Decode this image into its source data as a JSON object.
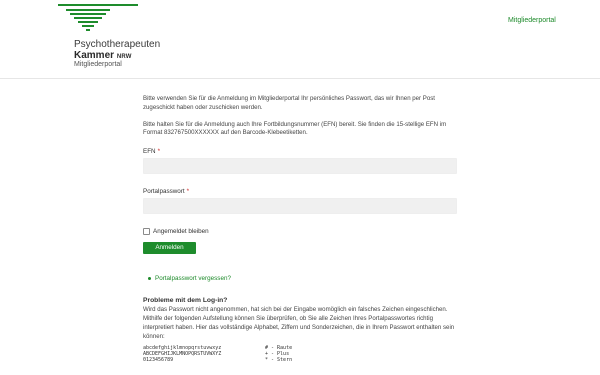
{
  "header": {
    "brand_line1": "Psychotherapeuten",
    "brand_line2": "Kammer",
    "brand_line2_suffix": "NRW",
    "brand_line3": "Mitgliederportal",
    "logo_icon": "stacked-green-lines-triangle-logo",
    "nav_link": "Mitgliederportal"
  },
  "main": {
    "intro1": "Bitte verwenden Sie für die Anmeldung im Mitgliederportal Ihr persönliches Passwort, das wir Ihnen per Post zugeschickt haben oder zuschicken werden.",
    "intro2": "Bitte halten Sie für die Anmeldung auch Ihre Fortbildungsnummer (EFN) bereit. Sie finden die 15-stellige EFN im Format 832767500XXXXXX auf den Barcode-Klebeetiketten.",
    "efn_label": "EFN",
    "efn_value": "",
    "password_label": "Portalpasswort",
    "password_value": "",
    "required_mark": "*",
    "remember_label": "Angemeldet bleiben",
    "login_button": "Anmelden",
    "forgot_link": "Portalpasswort vergessen?",
    "problems_title": "Probleme mit dem Log-in?",
    "problems_text": "Wird das Passwort nicht angenommen, hat sich bei der Eingabe womöglich ein falsches Zeichen eingeschlichen. Mithilfe der folgenden Aufstellung können Sie überprüfen, ob Sie alle Zeichen Ihres Portalpasswortes richtig interpretiert haben. Hier das vollständige Alphabet, Ziffern und Sonderzeichen, die in Ihrem Passwort enthalten sein können:",
    "charset": [
      {
        "chars": "abcdefghijklmnopqrstuvwxyz",
        "symbol": "# - Raute"
      },
      {
        "chars": "ABCDEFGHIJKLMNOPQRSTUVWXYZ",
        "symbol": "+ - Plus"
      },
      {
        "chars": "0123456789",
        "symbol": "* - Stern"
      }
    ]
  },
  "colors": {
    "accent_green": "#1e8c2c",
    "required_red": "#cc1f1f",
    "field_bg": "#f0f0f0"
  }
}
